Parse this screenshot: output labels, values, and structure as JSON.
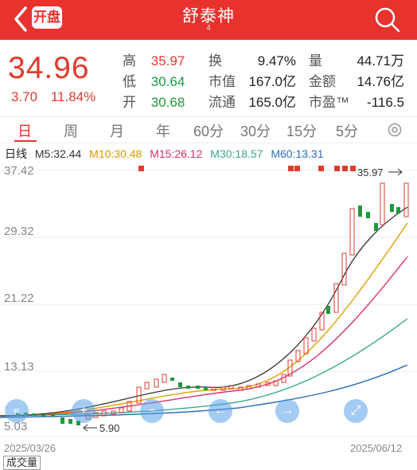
{
  "header": {
    "title": "舒泰神",
    "subtitle": "4",
    "badge": "开盘",
    "bg_color": "#e8322e"
  },
  "quote": {
    "price": "34.96",
    "change": "3.70",
    "change_pct": "11.84%",
    "rows": [
      {
        "l1": "高",
        "v1": "35.97",
        "l2": "换",
        "v2": "9.47%",
        "l3": "量",
        "v3": "44.71万"
      },
      {
        "l1": "低",
        "v1": "30.64",
        "l2": "市值",
        "v2": "167.0亿",
        "l3": "金额",
        "v3": "14.76亿"
      },
      {
        "l1": "开",
        "v1": "30.68",
        "l2": "流通",
        "v2": "165.0亿",
        "l3": "市盈™",
        "v3": "-116.5"
      }
    ]
  },
  "periods": [
    "日",
    "周",
    "月",
    "年",
    "60分",
    "30分",
    "15分",
    "5分"
  ],
  "active_period": "日",
  "ma": {
    "label": "日线",
    "m5": "M5:32.44",
    "m10": "M10:30.48",
    "m15": "M15:26.12",
    "m30": "M30:18.57",
    "m60": "M60:13.31",
    "colors": {
      "m5": "#333333",
      "m10": "#e0a100",
      "m15": "#d6336c",
      "m30": "#3aa98f",
      "m60": "#2e6fb8"
    }
  },
  "chart": {
    "y_labels": [
      "37.42",
      "29.32",
      "21.22",
      "13.13",
      "5.03"
    ],
    "high_label": "35.97",
    "low_label": "5.90",
    "date_start": "2025/03/26",
    "date_end": "2025/06/12",
    "volume_tab": "成交量"
  }
}
